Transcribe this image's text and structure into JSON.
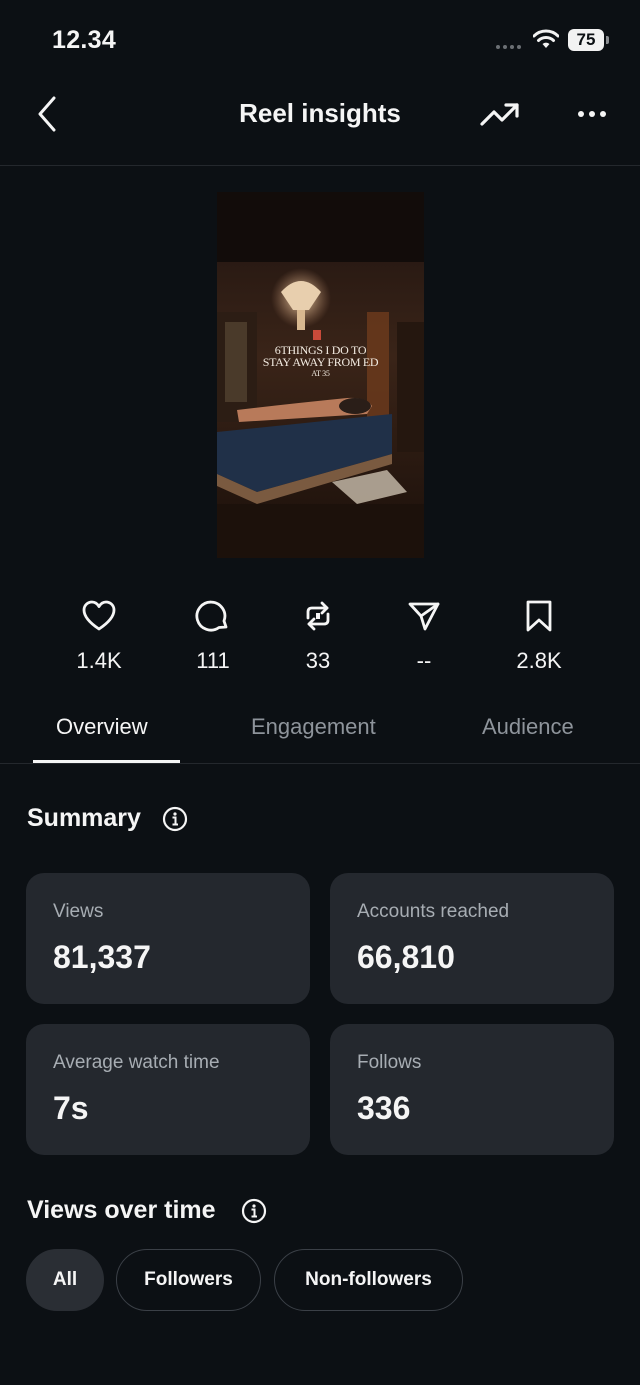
{
  "status_bar": {
    "time": "12.34",
    "battery": "75"
  },
  "header": {
    "title": "Reel insights"
  },
  "reel": {
    "caption_line1": "6THINGS I DO TO",
    "caption_line2": "STAY AWAY FROM ED",
    "caption_line3": "AT 35"
  },
  "engagement_stats": [
    {
      "icon": "heart-icon",
      "value": "1.4K"
    },
    {
      "icon": "comment-icon",
      "value": "111"
    },
    {
      "icon": "repost-icon",
      "value": "33"
    },
    {
      "icon": "share-icon",
      "value": "--"
    },
    {
      "icon": "save-icon",
      "value": "2.8K"
    }
  ],
  "tabs": [
    {
      "label": "Overview",
      "active": true
    },
    {
      "label": "Engagement",
      "active": false
    },
    {
      "label": "Audience",
      "active": false
    }
  ],
  "summary": {
    "title": "Summary",
    "cards": [
      {
        "label": "Views",
        "value": "81,337"
      },
      {
        "label": "Accounts reached",
        "value": "66,810"
      },
      {
        "label": "Average watch time",
        "value": "7s"
      },
      {
        "label": "Follows",
        "value": "336"
      }
    ]
  },
  "views_over_time": {
    "title": "Views over time",
    "filters": [
      {
        "label": "All",
        "selected": true
      },
      {
        "label": "Followers",
        "selected": false
      },
      {
        "label": "Non-followers",
        "selected": false
      }
    ]
  },
  "colors": {
    "background": "#0c1014",
    "card": "#24282e",
    "text": "#f5f5f5",
    "muted": "#a7adb3"
  }
}
